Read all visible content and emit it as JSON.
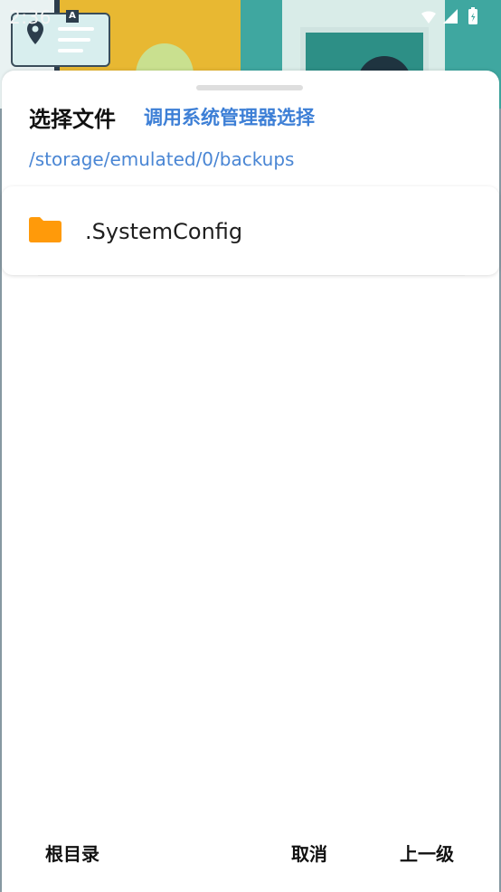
{
  "status_bar": {
    "time": "2:36",
    "notification_icon": "A"
  },
  "dialog": {
    "title": "选择文件",
    "system_picker_link": "调用系统管理器选择",
    "current_path": "/storage/emulated/0/backups",
    "items": [
      {
        "name": ".SystemConfig",
        "icon": "folder-icon",
        "icon_color": "#ff9a0a"
      }
    ],
    "buttons": {
      "root": "根目录",
      "cancel": "取消",
      "up": "上一级"
    }
  },
  "colors": {
    "accent": "#3d7fd6",
    "folder": "#ff9a0a"
  }
}
